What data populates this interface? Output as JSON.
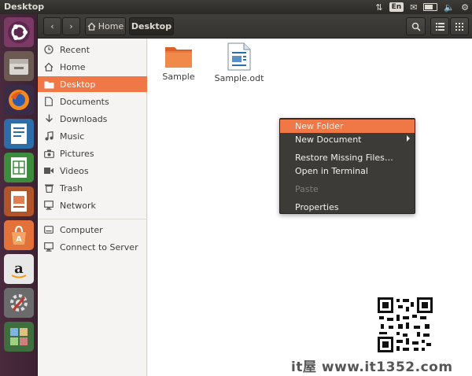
{
  "window": {
    "title": "Desktop"
  },
  "top_panel": {
    "icons": [
      "sort-arrows-icon",
      "keyboard-layout-icon",
      "mail-icon",
      "battery-icon",
      "volume-icon",
      "settings-gear-icon"
    ],
    "keyboard_layout": "En"
  },
  "launcher": {
    "items": [
      {
        "name": "ubuntu-dash-icon"
      },
      {
        "name": "files-icon",
        "running": true
      },
      {
        "name": "firefox-icon"
      },
      {
        "name": "writer-icon"
      },
      {
        "name": "calc-icon"
      },
      {
        "name": "impress-icon"
      },
      {
        "name": "software-center-icon"
      },
      {
        "name": "amazon-icon"
      },
      {
        "name": "system-settings-icon"
      },
      {
        "name": "workspaces-icon"
      }
    ]
  },
  "toolbar": {
    "back": "back-arrow-icon",
    "forward": "forward-arrow-icon",
    "breadcrumb_home": "Home",
    "breadcrumb_current": "Desktop",
    "search": "search-icon",
    "list_view": "list-view-icon",
    "grid_view": "grid-view-icon"
  },
  "sidebar": {
    "items": [
      {
        "label": "Recent",
        "icon": "clock-icon"
      },
      {
        "label": "Home",
        "icon": "home-icon"
      },
      {
        "label": "Desktop",
        "icon": "folder-icon",
        "active": true
      },
      {
        "label": "Documents",
        "icon": "document-icon"
      },
      {
        "label": "Downloads",
        "icon": "download-icon"
      },
      {
        "label": "Music",
        "icon": "music-note-icon"
      },
      {
        "label": "Pictures",
        "icon": "camera-icon"
      },
      {
        "label": "Videos",
        "icon": "video-icon"
      },
      {
        "label": "Trash",
        "icon": "trash-icon"
      },
      {
        "label": "Network",
        "icon": "network-icon"
      },
      {
        "label": "Computer",
        "icon": "drive-icon"
      },
      {
        "label": "Connect to Server",
        "icon": "server-icon"
      }
    ]
  },
  "files": [
    {
      "name": "Sample",
      "type": "folder"
    },
    {
      "name": "Sample.odt",
      "type": "odt-document"
    }
  ],
  "context_menu": {
    "items": [
      {
        "label": "New Folder",
        "highlighted": true
      },
      {
        "label": "New Document",
        "submenu": true
      },
      {
        "label": "Restore Missing Files…"
      },
      {
        "label": "Open in Terminal"
      },
      {
        "label": "Paste",
        "disabled": true
      },
      {
        "label": "Properties"
      }
    ]
  },
  "watermark": "it屋 www.it1352.com",
  "colors": {
    "accent": "#f07746",
    "panel": "#3c3b37",
    "launcher": "#4a2a3e"
  }
}
